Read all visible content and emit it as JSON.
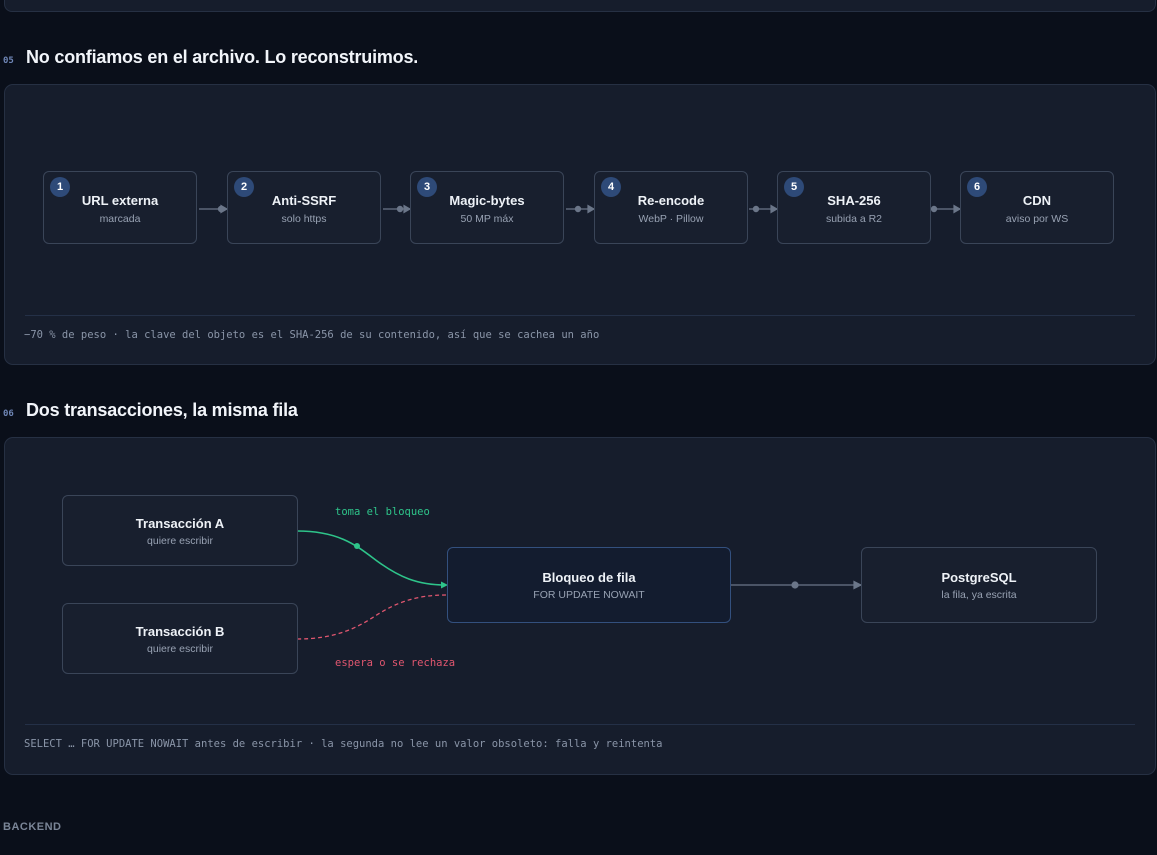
{
  "section05": {
    "number": "05",
    "title": "No confiamos en el archivo. Lo reconstruimos.",
    "steps": [
      {
        "num": "1",
        "title": "URL externa",
        "sub": "marcada"
      },
      {
        "num": "2",
        "title": "Anti-SSRF",
        "sub": "solo https"
      },
      {
        "num": "3",
        "title": "Magic-bytes",
        "sub": "50 MP máx"
      },
      {
        "num": "4",
        "title": "Re-encode",
        "sub": "WebP · Pillow"
      },
      {
        "num": "5",
        "title": "SHA-256",
        "sub": "subida a R2"
      },
      {
        "num": "6",
        "title": "CDN",
        "sub": "aviso por WS"
      }
    ],
    "note": "−70 % de peso · la clave del objeto es el SHA-256 de su contenido, así que se cachea un año"
  },
  "section06": {
    "number": "06",
    "title": "Dos transacciones, la misma fila",
    "txA": {
      "title": "Transacción A",
      "sub": "quiere escribir"
    },
    "txB": {
      "title": "Transacción B",
      "sub": "quiere escribir"
    },
    "lock": {
      "title": "Bloqueo de fila",
      "sub": "FOR UPDATE NOWAIT"
    },
    "db": {
      "title": "PostgreSQL",
      "sub": "la fila, ya escrita"
    },
    "labelA": "toma el bloqueo",
    "labelB": "espera o se rechaza",
    "note": "SELECT … FOR UPDATE NOWAIT antes de escribir · la segunda no lee un valor obsoleto: falla y reintenta"
  },
  "footer": {
    "label": "BACKEND"
  },
  "colors": {
    "accent_green": "#2ec48a",
    "accent_red": "#e0566f",
    "badge_blue": "#2e4a78",
    "connector": "#6b7689"
  }
}
